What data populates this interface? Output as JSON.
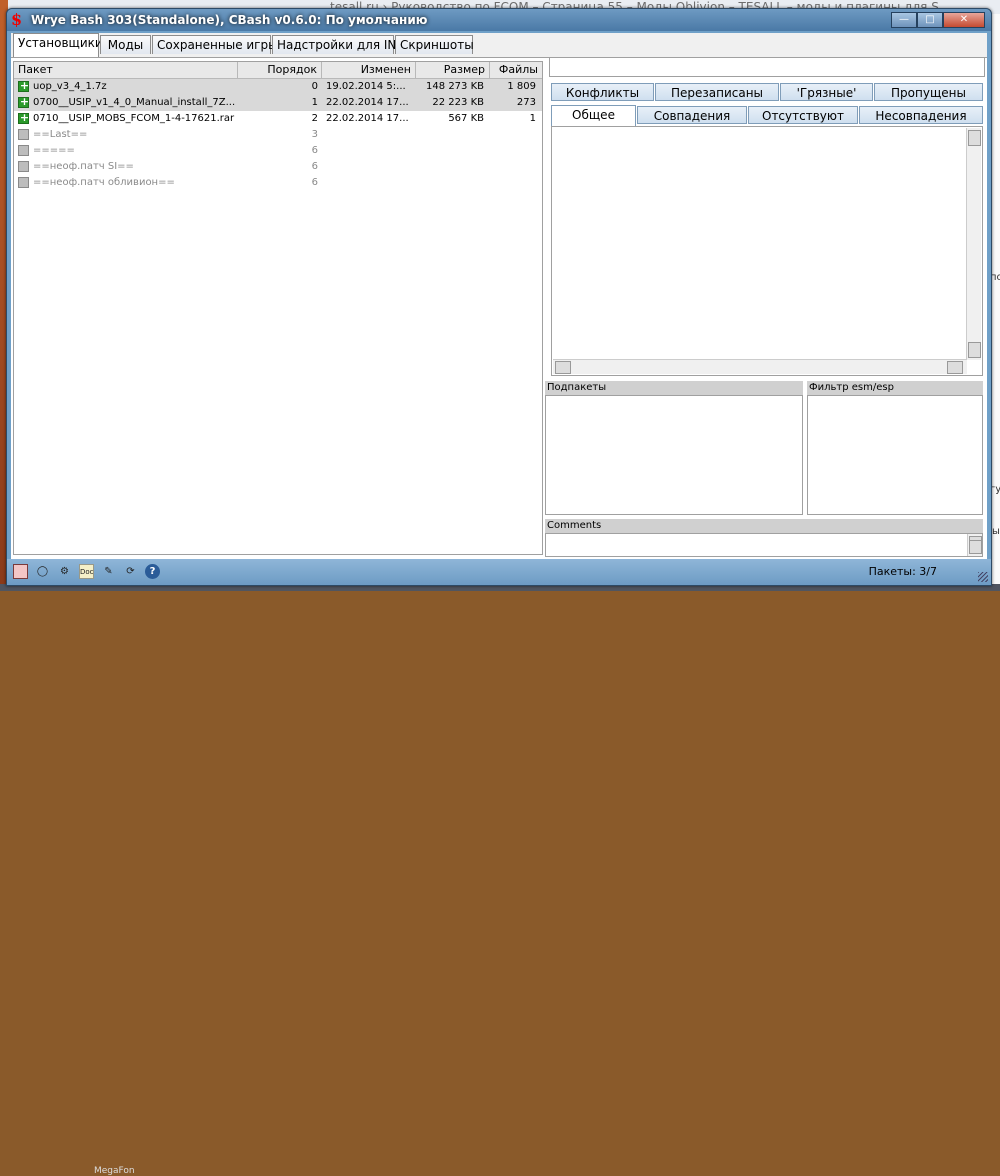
{
  "window": {
    "title": "Wrye Bash 303(Standalone), CBash v0.6.0: По умолчанию"
  },
  "background": {
    "browser_text": "tesall.ru › Руководство по FCOM – Страница 55 – Моды Oblivion – TESALL – моды и плагины для S",
    "taskbar_text": "MegaFon",
    "right_fragments": [
      "по",
      "гу",
      "ы"
    ]
  },
  "tabs": [
    {
      "label": "Установщики",
      "active": true
    },
    {
      "label": "Моды",
      "active": false
    },
    {
      "label": "Сохраненные игры",
      "active": false
    },
    {
      "label": "Надстройки для INI",
      "active": false
    },
    {
      "label": "Скриншоты",
      "active": false
    }
  ],
  "installers": {
    "columns": [
      "Пакет",
      "Порядок",
      "Изменен",
      "Размер",
      "Файлы"
    ],
    "rows": [
      {
        "name": "uop_v3_4_1.7z",
        "order": "0",
        "modified": "19.02.2014 5:...",
        "size": "148 273 KB",
        "files": "1 809",
        "icon": "plus",
        "selected": true
      },
      {
        "name": "0700__USIP_v1_4_0_Manual_install_7Z...",
        "order": "1",
        "modified": "22.02.2014 17...",
        "size": "22 223 KB",
        "files": "273",
        "icon": "plus",
        "selected": true
      },
      {
        "name": "0710__USIP_MOBS_FCOM_1-4-17621.rar",
        "order": "2",
        "modified": "22.02.2014 17...",
        "size": "567 KB",
        "files": "1",
        "icon": "plus",
        "selected": false
      },
      {
        "name": "==Last==",
        "order": "3",
        "modified": "",
        "size": "",
        "files": "",
        "icon": "gray",
        "selected": false
      },
      {
        "name": "=====",
        "order": "6",
        "modified": "",
        "size": "",
        "files": "",
        "icon": "gray",
        "selected": false
      },
      {
        "name": "==неоф.патч SI==",
        "order": "6",
        "modified": "",
        "size": "",
        "files": "",
        "icon": "gray",
        "selected": false
      },
      {
        "name": "==неоф.патч обливион==",
        "order": "6",
        "modified": "",
        "size": "",
        "files": "",
        "icon": "gray",
        "selected": false
      }
    ]
  },
  "details_tabs_row1": [
    "Конфликты",
    "Перезаписаны",
    "'Грязные'",
    "Пропущены"
  ],
  "details_tabs_row2": [
    "Общее",
    "Совпадения",
    "Отсутствуют",
    "Несовпадения"
  ],
  "panels": {
    "subpackages": "Подпакеты",
    "esm_filter": "Фильтр esm/esp",
    "comments": "Comments"
  },
  "status": {
    "packages": "Пакеты: 3/7"
  },
  "statusbar_icons": [
    "settings-icon",
    "oblivion-icon",
    "tes-construction-set-icon",
    "doc-browser-icon",
    "mod-checker-icon",
    "restart-icon",
    "help-icon"
  ]
}
